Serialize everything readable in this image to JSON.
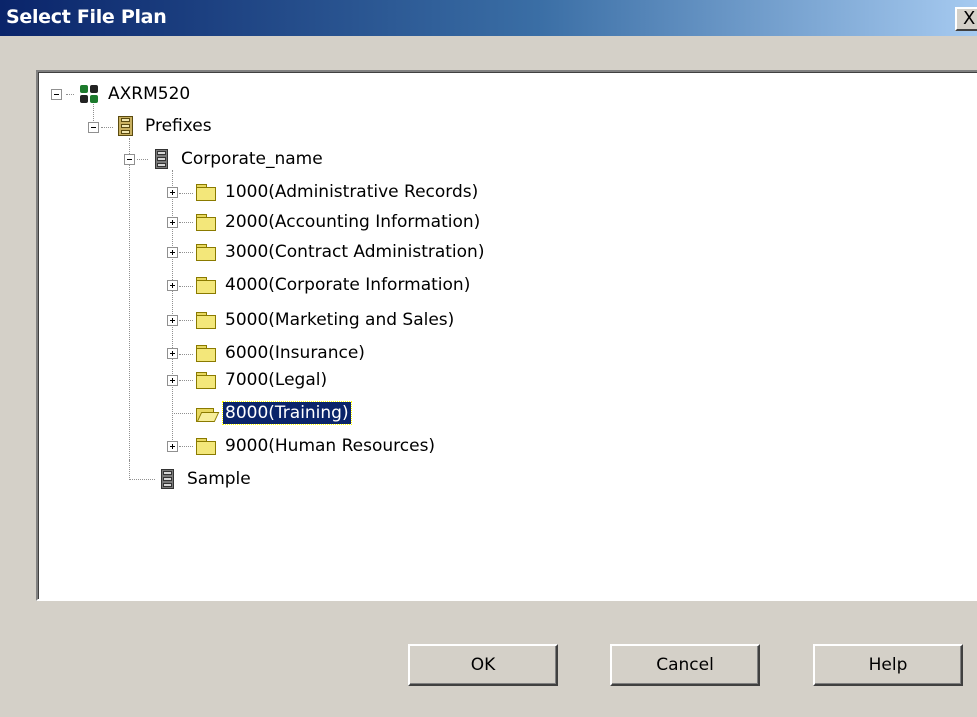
{
  "window": {
    "title": "Select File Plan",
    "close_label": "X"
  },
  "tree": {
    "root": {
      "label": "AXRM520",
      "icon": "server-icon"
    },
    "prefixes": {
      "label": "Prefixes",
      "icon": "prefix-cabinet-icon"
    },
    "corporate": {
      "label": "Corporate_name",
      "icon": "cabinet-icon"
    },
    "folders": [
      {
        "label": "1000(Administrative Records)",
        "icon": "folder-icon",
        "expander": "plus"
      },
      {
        "label": "2000(Accounting Information)",
        "icon": "folder-icon",
        "expander": "plus"
      },
      {
        "label": "3000(Contract Administration)",
        "icon": "folder-icon",
        "expander": "plus"
      },
      {
        "label": "4000(Corporate Information)",
        "icon": "folder-icon",
        "expander": "plus"
      },
      {
        "label": "5000(Marketing and Sales)",
        "icon": "folder-icon",
        "expander": "plus"
      },
      {
        "label": "6000(Insurance)",
        "icon": "folder-icon",
        "expander": "plus"
      },
      {
        "label": "7000(Legal)",
        "icon": "folder-icon",
        "expander": "plus"
      },
      {
        "label": "8000(Training)",
        "icon": "folder-open-icon",
        "expander": "none",
        "selected": true
      },
      {
        "label": "9000(Human Resources)",
        "icon": "folder-icon",
        "expander": "plus"
      }
    ],
    "sample": {
      "label": "Sample",
      "icon": "cabinet-icon"
    }
  },
  "buttons": {
    "ok": "OK",
    "cancel": "Cancel",
    "help": "Help"
  },
  "colors": {
    "title_start": "#0a246a",
    "title_end": "#a6caf0",
    "selection": "#0a246a",
    "dialog_bg": "#d4d0c8"
  }
}
